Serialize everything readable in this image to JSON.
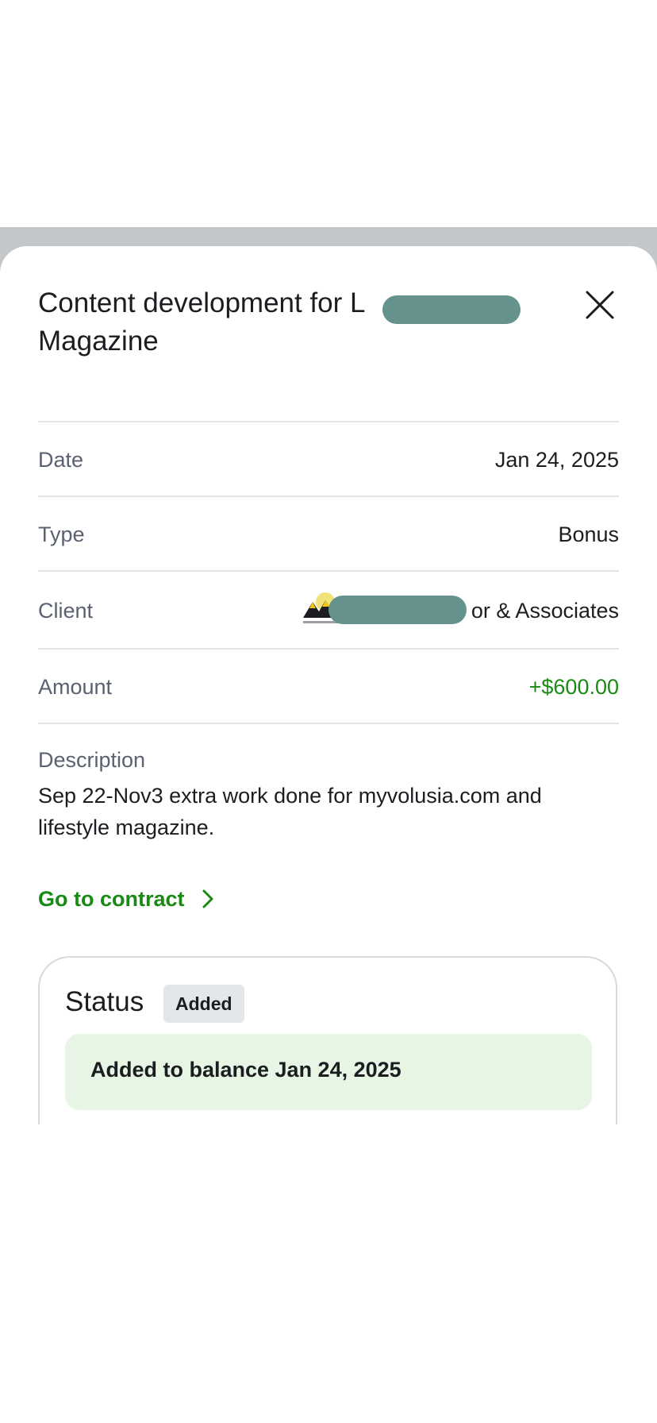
{
  "header": {
    "title": "Content development for L",
    "title_line2": "Magazine"
  },
  "icons": {
    "close": "close-icon",
    "chevron": "chevron-right-icon"
  },
  "details": {
    "date_label": "Date",
    "date_value": "Jan 24, 2025",
    "type_label": "Type",
    "type_value": "Bonus",
    "client_label": "Client",
    "client_value": "or & Associates",
    "amount_label": "Amount",
    "amount_value": "+$600.00"
  },
  "description": {
    "label": "Description",
    "text": "Sep 22-Nov3 extra work done for myvolusia.com and lifestyle magazine."
  },
  "contract_link": {
    "label": "Go to contract"
  },
  "status": {
    "title": "Status",
    "badge": "Added",
    "note": "Added to balance Jan 24, 2025"
  },
  "colors": {
    "accent_green": "#1a8a14",
    "note_bg": "#e6f5e4",
    "muted_text": "#5a6170"
  }
}
